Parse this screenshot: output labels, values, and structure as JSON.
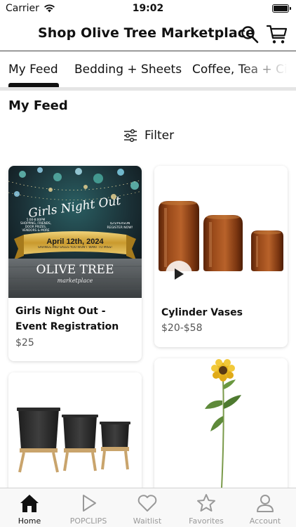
{
  "status_bar": {
    "carrier": "Carrier",
    "time": "19:02"
  },
  "header": {
    "title": "Shop Olive Tree Marketplace"
  },
  "tabs": [
    {
      "label": "My Feed"
    },
    {
      "label": "Bedding + Sheets"
    },
    {
      "label": "Coffee, Tea + Ci"
    }
  ],
  "section": {
    "title": "My Feed"
  },
  "filter": {
    "label": "Filter"
  },
  "products": [
    {
      "name": "Girls Night Out - Event Registration",
      "price": "$25",
      "image": {
        "script_title": "Girls Night Out",
        "left_text": "5:00-8:00PM SHOPPING, FRIENDS, DOOR PRIZES, VENDORS & MORE",
        "right_text": "$25/PERSON REGISTER NOW!",
        "date": "April 12th, 2024",
        "tagline": "SAVINGS AND SALES YOU WON'T WANT TO MISS!",
        "brand": "OLIVE TREE",
        "brand_sub": "marketplace"
      }
    },
    {
      "name": "Cylinder Vases",
      "price": "$20-$58"
    },
    {
      "name": "",
      "price": ""
    },
    {
      "name": "",
      "price": ""
    }
  ],
  "tabbar": [
    {
      "label": "Home",
      "icon": "home-icon"
    },
    {
      "label": "POPCLIPS",
      "icon": "play-icon"
    },
    {
      "label": "Waitlist",
      "icon": "heart-icon"
    },
    {
      "label": "Favorites",
      "icon": "star-icon"
    },
    {
      "label": "Account",
      "icon": "person-icon"
    }
  ],
  "colors": {
    "accent": "#111111",
    "inactive": "#999999",
    "vase_amber": "#8a3f16",
    "planter_black": "#2c2c2c",
    "sunflower": "#e8b820"
  }
}
